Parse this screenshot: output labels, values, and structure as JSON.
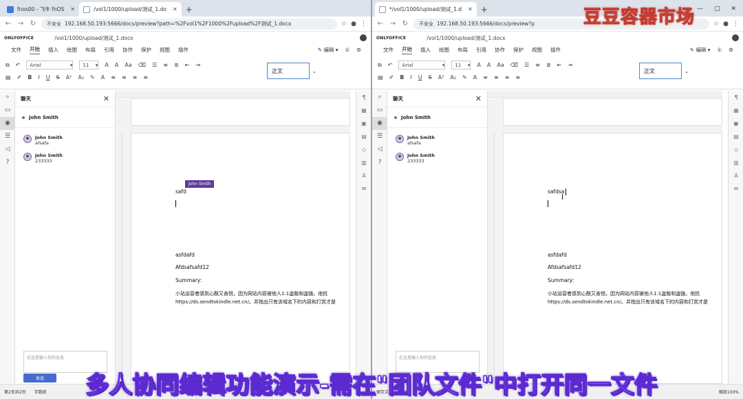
{
  "windows": [
    {
      "tabs": [
        {
          "label": "fnos00 - 飞牛 fnOS",
          "active": false
        },
        {
          "label": "/vol1/1000/upload/测试_1.do",
          "active": true
        }
      ],
      "url": "192.168.50.193:5666/docs/preview?path=%2Fvol1%2F1000%2Fupload%2F测试_1.docx",
      "security": "不安全",
      "doc_title": "/vol1/1000/upload/测试_1.docx",
      "remote_cursor_text": "safd",
      "remote_user_tag": "John Smith"
    },
    {
      "tabs": [
        {
          "label": "*/vol1/1000/upload/测试_1.d",
          "active": true
        }
      ],
      "url": "192.168.50.193:5666/docs/preview?p",
      "security": "不安全",
      "doc_title": "/vol1/1000/upload/测试_1.docx",
      "remote_cursor_text": "safdsa",
      "remote_user_tag": ""
    }
  ],
  "app": {
    "logo": "ONLYOFFICE",
    "menu": [
      "文件",
      "开始",
      "插入",
      "绘图",
      "布局",
      "引用",
      "协作",
      "保护",
      "视图",
      "插件"
    ],
    "active_menu": "开始",
    "edit_mode": "编辑",
    "font": "Arial",
    "font_size": "11",
    "style": "正文"
  },
  "chat": {
    "title": "聊天",
    "online_user": "John Smith",
    "messages": [
      {
        "name": "John Smith",
        "text": "afsafa"
      },
      {
        "name": "John Smith",
        "text": "233333"
      }
    ],
    "input_placeholder": "在这里输入你的信息",
    "send_label": "发送"
  },
  "document": {
    "lines": [
      "asfdafd",
      "Afdsafsafd12",
      "Summary:"
    ],
    "para1": "小站运营者感到心酸又善悦，因为网站内容被他人1:1盗版和盗链。他抗",
    "para2": "https://ds.sendtokindle.net.cn/。并指出只有该域名下的内容和打赏才是"
  },
  "status": {
    "page": "第2页共2页",
    "words": "字数统",
    "save": "保存文档",
    "zoom": "缩放100%"
  },
  "overlay": {
    "watermark": "豆豆容器市场",
    "subtitle": "多人协同编辑功能演示-需在\"团队文件\"中打开同一文件"
  }
}
